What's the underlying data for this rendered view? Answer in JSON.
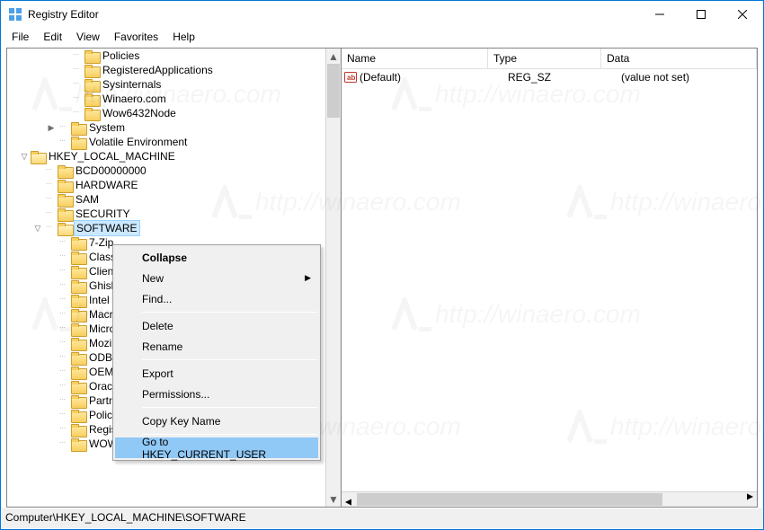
{
  "title": "Registry Editor",
  "menus": [
    "File",
    "Edit",
    "View",
    "Favorites",
    "Help"
  ],
  "tree": [
    {
      "indent": 57,
      "exp": "",
      "label": "Policies"
    },
    {
      "indent": 57,
      "exp": "",
      "label": "RegisteredApplications"
    },
    {
      "indent": 57,
      "exp": "",
      "label": "Sysinternals"
    },
    {
      "indent": 57,
      "exp": "",
      "label": "Winaero.com"
    },
    {
      "indent": 57,
      "exp": "",
      "label": "Wow6432Node"
    },
    {
      "indent": 42,
      "exp": ">",
      "label": "System"
    },
    {
      "indent": 42,
      "exp": "",
      "label": "Volatile Environment"
    },
    {
      "indent": 12,
      "exp": "v",
      "label": "HKEY_LOCAL_MACHINE",
      "open": true
    },
    {
      "indent": 27,
      "exp": "",
      "label": "BCD00000000"
    },
    {
      "indent": 27,
      "exp": "",
      "label": "HARDWARE"
    },
    {
      "indent": 27,
      "exp": "",
      "label": "SAM"
    },
    {
      "indent": 27,
      "exp": "",
      "label": "SECURITY"
    },
    {
      "indent": 27,
      "exp": "v",
      "label": "SOFTWARE",
      "selected": true,
      "open": true
    },
    {
      "indent": 42,
      "exp": "",
      "label": "7-Zip"
    },
    {
      "indent": 42,
      "exp": "",
      "label": "Class"
    },
    {
      "indent": 42,
      "exp": "",
      "label": "Clien"
    },
    {
      "indent": 42,
      "exp": "",
      "label": "Ghisl"
    },
    {
      "indent": 42,
      "exp": "",
      "label": "Intel"
    },
    {
      "indent": 42,
      "exp": "",
      "label": "Macr"
    },
    {
      "indent": 42,
      "exp": "",
      "label": "Micro"
    },
    {
      "indent": 42,
      "exp": "",
      "label": "Mozi"
    },
    {
      "indent": 42,
      "exp": "",
      "label": "ODBC"
    },
    {
      "indent": 42,
      "exp": "",
      "label": "OEM"
    },
    {
      "indent": 42,
      "exp": "",
      "label": "Oracl"
    },
    {
      "indent": 42,
      "exp": "",
      "label": "Partn"
    },
    {
      "indent": 42,
      "exp": "",
      "label": "Policies"
    },
    {
      "indent": 42,
      "exp": "",
      "label": "RegisteredApplications"
    },
    {
      "indent": 42,
      "exp": "",
      "label": "WOW6432Node"
    }
  ],
  "columns": {
    "name": "Name",
    "type": "Type",
    "data": "Data"
  },
  "values": [
    {
      "name": "(Default)",
      "type": "REG_SZ",
      "data": "(value not set)"
    }
  ],
  "context_menu": [
    {
      "label": "Collapse",
      "bold": true
    },
    {
      "label": "New",
      "submenu": true
    },
    {
      "label": "Find..."
    },
    {
      "sep": true
    },
    {
      "label": "Delete"
    },
    {
      "label": "Rename"
    },
    {
      "sep": true
    },
    {
      "label": "Export"
    },
    {
      "label": "Permissions..."
    },
    {
      "sep": true
    },
    {
      "label": "Copy Key Name"
    },
    {
      "sep": true
    },
    {
      "label": "Go to HKEY_CURRENT_USER",
      "highlight": true
    }
  ],
  "statusbar": "Computer\\HKEY_LOCAL_MACHINE\\SOFTWARE",
  "watermark": "http://winaero.com"
}
